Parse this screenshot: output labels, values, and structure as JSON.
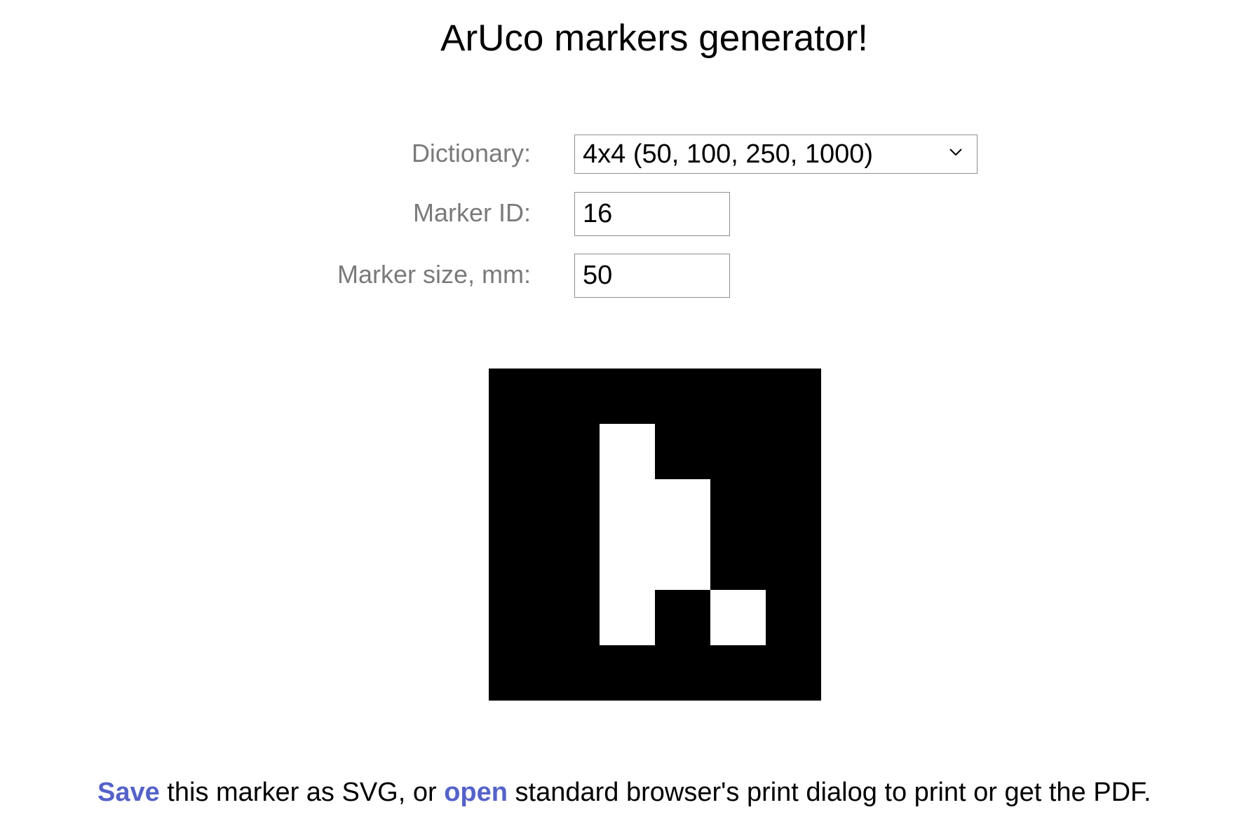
{
  "title": "ArUco markers generator!",
  "form": {
    "dictionary_label": "Dictionary:",
    "dictionary_value": "4x4 (50, 100, 250, 1000)",
    "marker_id_label": "Marker ID:",
    "marker_id_value": "16",
    "marker_size_label": "Marker size, mm:",
    "marker_size_value": "50"
  },
  "marker": {
    "grid": 4,
    "bits": [
      [
        0,
        1,
        0,
        0
      ],
      [
        0,
        1,
        1,
        0
      ],
      [
        0,
        1,
        1,
        0
      ],
      [
        0,
        1,
        0,
        1
      ]
    ]
  },
  "footer": {
    "save_link": "Save",
    "text1": " this marker as SVG, or ",
    "open_link": "open",
    "text2": " standard browser's print dialog to print or get the PDF."
  },
  "colors": {
    "link": "#5562c9",
    "label": "#7a7a7a"
  }
}
